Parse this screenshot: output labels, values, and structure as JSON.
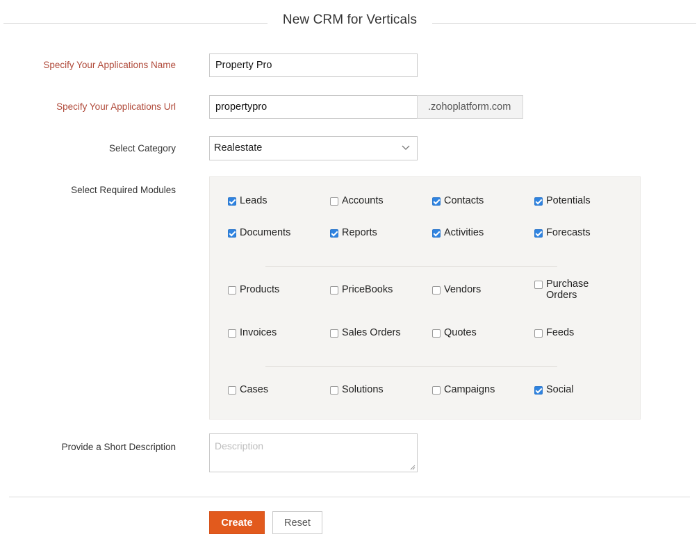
{
  "title": "New CRM for Verticals",
  "form": {
    "app_name_label": "Specify Your Applications Name",
    "app_name_value": "Property Pro",
    "app_url_label": "Specify Your Applications Url",
    "app_url_value": "propertypro",
    "app_url_suffix": ".zohoplatform.com",
    "category_label": "Select Category",
    "category_value": "Realestate",
    "modules_label": "Select Required Modules",
    "description_label": "Provide a Short Description",
    "description_placeholder": "Description"
  },
  "modules": [
    {
      "label": "Leads",
      "checked": true
    },
    {
      "label": "Accounts",
      "checked": false
    },
    {
      "label": "Contacts",
      "checked": true
    },
    {
      "label": "Potentials",
      "checked": true
    },
    {
      "label": "Documents",
      "checked": true
    },
    {
      "label": "Reports",
      "checked": true
    },
    {
      "label": "Activities",
      "checked": true
    },
    {
      "label": "Forecasts",
      "checked": true
    },
    {
      "label": "Products",
      "checked": false
    },
    {
      "label": "PriceBooks",
      "checked": false
    },
    {
      "label": "Vendors",
      "checked": false
    },
    {
      "label": "Purchase Orders",
      "checked": false
    },
    {
      "label": "Invoices",
      "checked": false
    },
    {
      "label": "Sales Orders",
      "checked": false
    },
    {
      "label": "Quotes",
      "checked": false
    },
    {
      "label": "Feeds",
      "checked": false
    },
    {
      "label": "Cases",
      "checked": false
    },
    {
      "label": "Solutions",
      "checked": false
    },
    {
      "label": "Campaigns",
      "checked": false
    },
    {
      "label": "Social",
      "checked": true
    }
  ],
  "buttons": {
    "create": "Create",
    "reset": "Reset"
  },
  "colors": {
    "accent": "#e25a1d",
    "required_label": "#b04a3a",
    "checkbox_checked": "#2f83e0"
  }
}
